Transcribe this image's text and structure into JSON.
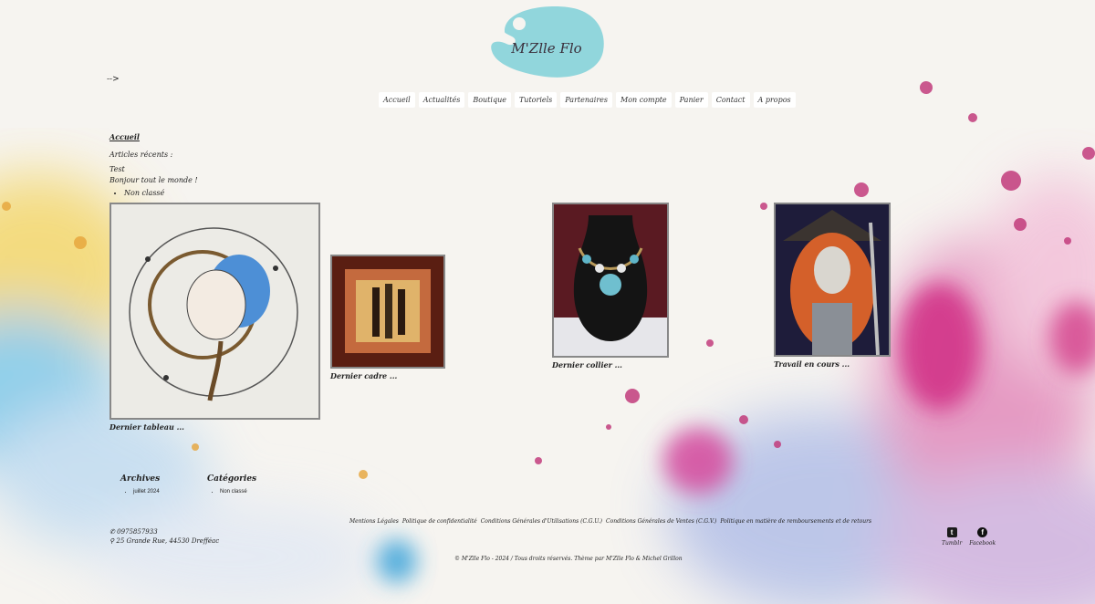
{
  "site": {
    "logo_text": "M'Zlle Flo",
    "stray_text": "-->"
  },
  "nav": {
    "items": [
      "Accueil",
      "Actualités",
      "Boutique",
      "Tutoriels",
      "Partenaires",
      "Mon compte",
      "Panier",
      "Contact",
      "A propos"
    ]
  },
  "main": {
    "breadcrumb": "Accueil",
    "recent_heading": "Articles récents :",
    "recent_items": [
      "Test",
      "Bonjour tout le monde !"
    ],
    "category": "Non classé"
  },
  "gallery": {
    "captions": [
      "Dernier tableau ...",
      "Dernier cadre ...",
      "Dernier collier ...",
      "Travail en cours ..."
    ]
  },
  "footer": {
    "archives_title": "Archives",
    "archives_item": "juillet 2024",
    "categories_title": "Catégories",
    "categories_item": "Non classé",
    "phone": "0975857933",
    "address": "25 Grande Rue, 44530 Drefféac",
    "legal_links": [
      "Mentions Légales",
      "Politique de confidentialité",
      "Conditions Générales d'Utilisations (C.G.U.)",
      "Conditions Générales de Ventes (C.G.V.)",
      "Politique en matière de remboursements et de retours"
    ],
    "copyright": "© M'Zlle Flo - 2024 / Tous droits réservés. Thème par M'Zlle Flo & Michel Grillon",
    "social": [
      "Tumblr",
      "Facebook"
    ]
  },
  "colors": {
    "tumblr": "#1b1b1b",
    "facebook": "#111111"
  }
}
